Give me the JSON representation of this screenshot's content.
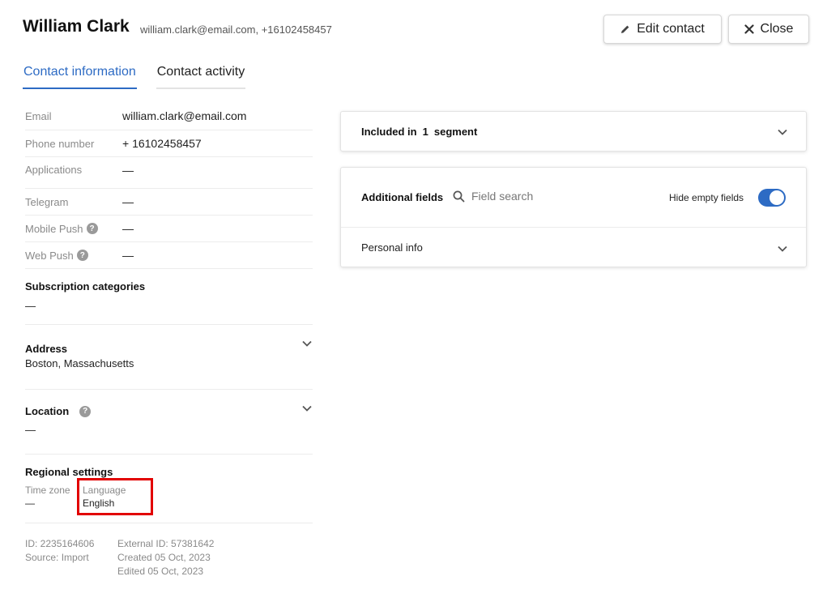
{
  "header": {
    "name": "William Clark",
    "subtitle": "william.clark@email.com, +16102458457",
    "edit_label": "Edit contact",
    "close_label": "Close"
  },
  "tabs": [
    {
      "label": "Contact information",
      "active": true
    },
    {
      "label": "Contact activity",
      "active": false
    }
  ],
  "fields": {
    "email": {
      "label": "Email",
      "value": "william.clark@email.com"
    },
    "phone": {
      "label": "Phone number",
      "value": "+ 16102458457"
    },
    "applications": {
      "label": "Applications",
      "value": "—"
    },
    "telegram": {
      "label": "Telegram",
      "value": "—"
    },
    "mobile_push": {
      "label": "Mobile Push",
      "value": "—"
    },
    "web_push": {
      "label": "Web Push",
      "value": "—"
    }
  },
  "subscription": {
    "title": "Subscription categories",
    "value": "—"
  },
  "address": {
    "title": "Address",
    "value": "Boston, Massachusetts"
  },
  "location": {
    "title": "Location",
    "value": "—"
  },
  "regional": {
    "title": "Regional settings",
    "timezone_label": "Time zone",
    "timezone_value": "—",
    "language_label": "Language",
    "language_value": "English"
  },
  "meta": {
    "id": "ID: 2235164606",
    "source": "Source:  Import",
    "external_id": "External ID: 57381642",
    "created": "Created 05 Oct, 2023",
    "edited": "Edited 05 Oct, 2023"
  },
  "segments": {
    "prefix": "Included in",
    "count": "1",
    "suffix": "segment"
  },
  "additional": {
    "title": "Additional fields",
    "search_placeholder": "Field search",
    "hide_empty_label": "Hide empty fields",
    "hide_empty_on": true,
    "personal_info": "Personal info"
  },
  "colors": {
    "accent": "#2d6bc4",
    "highlight": "#e20000"
  },
  "icons": [
    "pencil-icon",
    "close-icon",
    "help-icon",
    "chevron-down-icon",
    "search-icon"
  ]
}
